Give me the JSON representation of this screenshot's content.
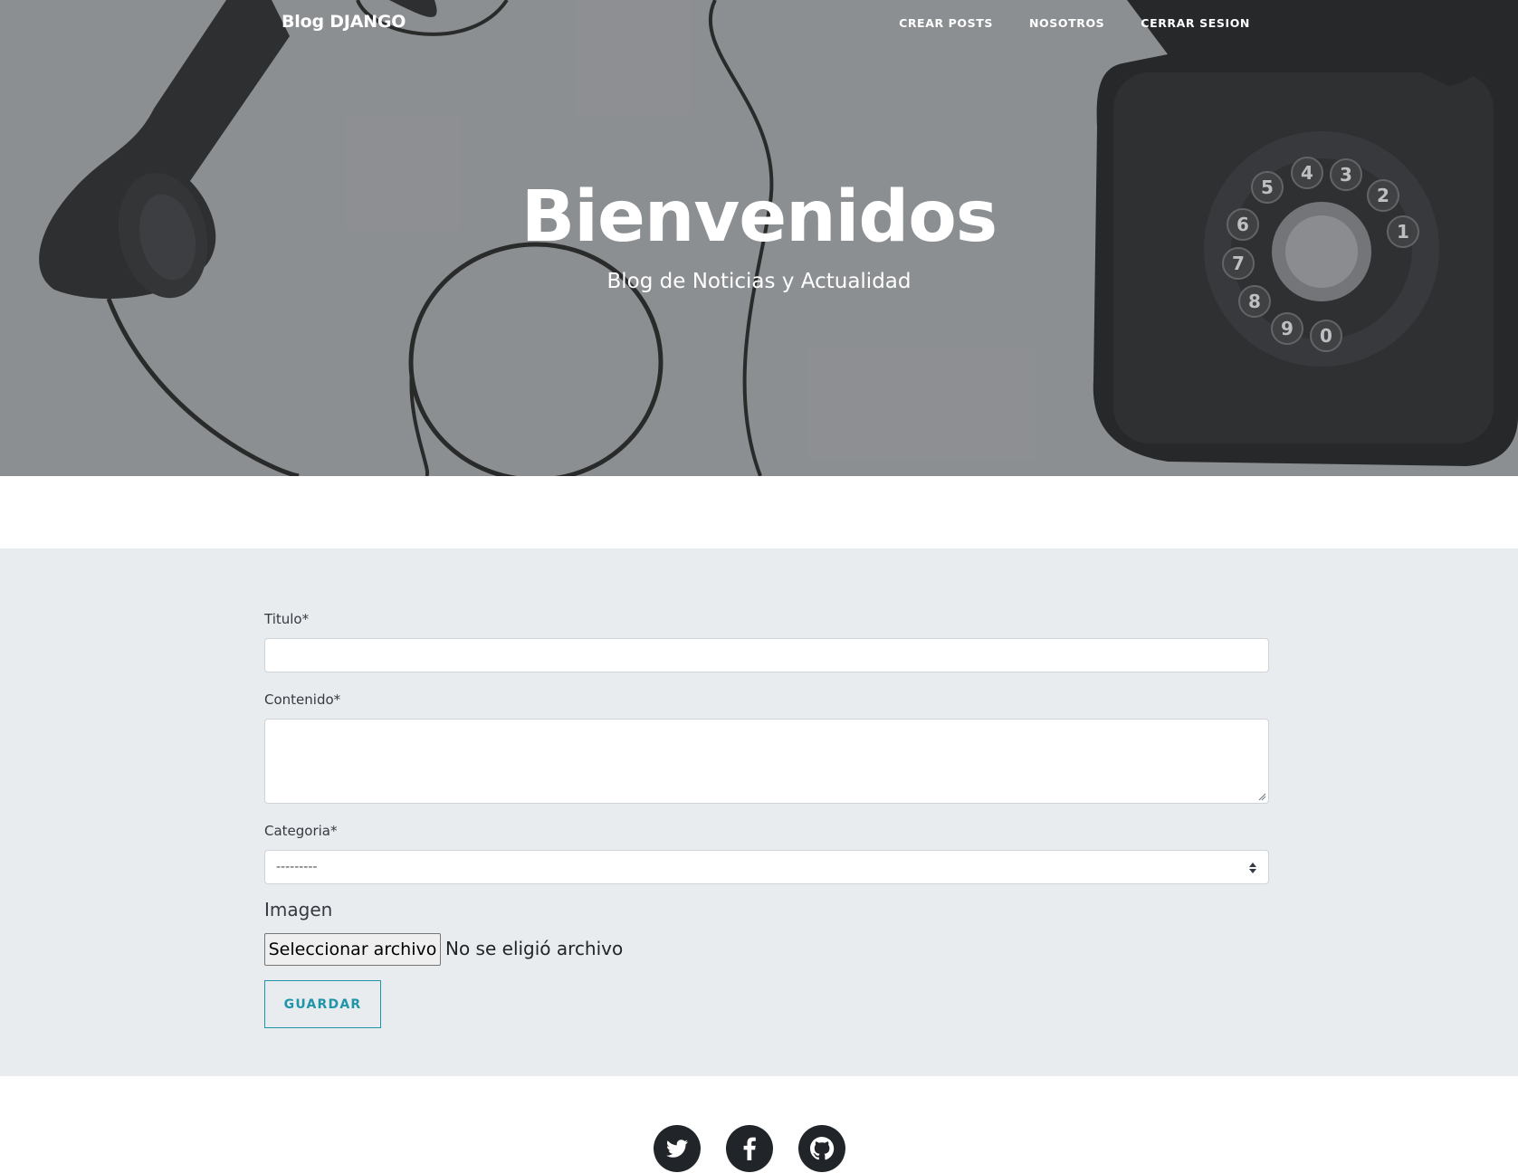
{
  "navbar": {
    "brand": "Blog DJANGO",
    "links": [
      "CREAR POSTS",
      "NOSOTROS",
      "CERRAR SESION"
    ]
  },
  "hero": {
    "title": "Bienvenidos",
    "subtitle": "Blog de Noticias y Actualidad"
  },
  "form": {
    "titulo_label": "Titulo*",
    "titulo_value": "",
    "contenido_label": "Contenido*",
    "contenido_value": "",
    "categoria_label": "Categoria*",
    "categoria_selected": "---------",
    "imagen_label": "Imagen",
    "file_button": "Seleccionar archivo",
    "file_status": "No se eligió archivo",
    "save_label": "GUARDAR"
  },
  "footer": {
    "social_icons": [
      "twitter-icon",
      "facebook-icon",
      "github-icon"
    ]
  },
  "colors": {
    "hero_bg": "#8e9094",
    "form_bg": "#e9ecef",
    "accent": "#1e95a8",
    "footer_icon_bg": "#212529"
  }
}
